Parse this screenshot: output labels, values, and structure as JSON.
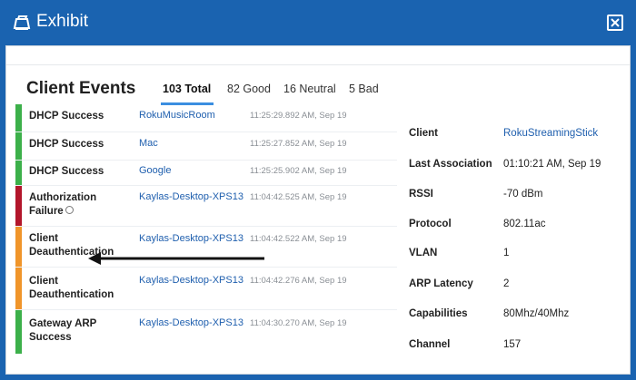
{
  "window": {
    "title": "Exhibit"
  },
  "card": {
    "title": "Client Events"
  },
  "filters": [
    {
      "label": "103 Total",
      "active": true
    },
    {
      "label": "82 Good",
      "active": false
    },
    {
      "label": "16 Neutral",
      "active": false
    },
    {
      "label": "5 Bad",
      "active": false
    }
  ],
  "events": [
    {
      "type": "DHCP Success",
      "type_line2": "",
      "client": "RokuMusicRoom",
      "time": "11:25:29.892 AM, Sep 19",
      "status": "good"
    },
    {
      "type": "DHCP Success",
      "type_line2": "",
      "client": "Mac",
      "time": "11:25:27.852 AM, Sep 19",
      "status": "good"
    },
    {
      "type": "DHCP Success",
      "type_line2": "",
      "client": "Google",
      "time": "11:25:25.902 AM, Sep 19",
      "status": "good"
    },
    {
      "type": "Authorization",
      "type_line2": "Failure",
      "client": "Kaylas-Desktop-XPS13",
      "time": "11:04:42.525 AM, Sep 19",
      "status": "bad"
    },
    {
      "type": "Client",
      "type_line2": "Deauthentication",
      "client": "Kaylas-Desktop-XPS13",
      "time": "11:04:42.522 AM, Sep 19",
      "status": "neutral"
    },
    {
      "type": "Client",
      "type_line2": "Deauthentication",
      "client": "Kaylas-Desktop-XPS13",
      "time": "11:04:42.276 AM, Sep 19",
      "status": "neutral"
    },
    {
      "type": "Gateway ARP",
      "type_line2": "Success",
      "client": "Kaylas-Desktop-XPS13",
      "time": "11:04:30.270 AM, Sep 19",
      "status": "good"
    }
  ],
  "status_colors": {
    "good": "#3cb04a",
    "bad": "#b3162b",
    "neutral": "#f0952a"
  },
  "details": [
    {
      "label": "Client",
      "value": "RokuStreamingStick",
      "link": true
    },
    {
      "label": "Last Association",
      "value": "01:10:21 AM, Sep 19",
      "link": false
    },
    {
      "label": "RSSI",
      "value": "-70 dBm",
      "link": false
    },
    {
      "label": "Protocol",
      "value": "802.11ac",
      "link": false
    },
    {
      "label": "VLAN",
      "value": "1",
      "link": false
    },
    {
      "label": "ARP Latency",
      "value": "2",
      "link": false
    },
    {
      "label": "Capabilities",
      "value": "80Mhz/40Mhz",
      "link": false
    },
    {
      "label": "Channel",
      "value": "157",
      "link": false
    }
  ],
  "icons": {
    "title": "exhibit-icon",
    "close": "close-icon",
    "info": "info-icon",
    "arrow": "arrow-left-icon"
  },
  "colors": {
    "titlebar": "#1a63b0",
    "link": "#1f5fae",
    "tab_accent": "#3b8ee0"
  }
}
